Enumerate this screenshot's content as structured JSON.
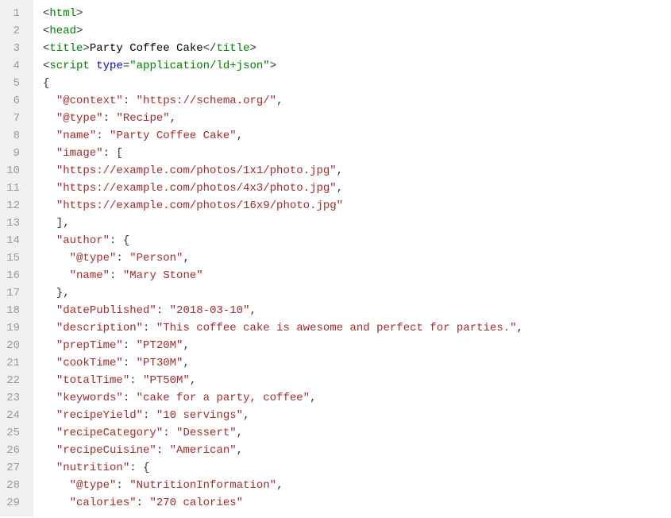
{
  "lines": [
    {
      "num": "1",
      "tokens": [
        [
          "punct",
          "<"
        ],
        [
          "tag",
          "html"
        ],
        [
          "punct",
          ">"
        ]
      ]
    },
    {
      "num": "2",
      "tokens": [
        [
          "punct",
          "<"
        ],
        [
          "tag",
          "head"
        ],
        [
          "punct",
          ">"
        ]
      ]
    },
    {
      "num": "3",
      "tokens": [
        [
          "punct",
          "<"
        ],
        [
          "tag",
          "title"
        ],
        [
          "punct",
          ">"
        ],
        [
          "text",
          "Party Coffee Cake"
        ],
        [
          "punct",
          "</"
        ],
        [
          "tag",
          "title"
        ],
        [
          "punct",
          ">"
        ]
      ]
    },
    {
      "num": "4",
      "tokens": [
        [
          "punct",
          "<"
        ],
        [
          "tag",
          "script"
        ],
        [
          "punct",
          " "
        ],
        [
          "attr",
          "type"
        ],
        [
          "punct",
          "="
        ],
        [
          "tag",
          "\"application/ld+json\""
        ],
        [
          "punct",
          ">"
        ]
      ]
    },
    {
      "num": "5",
      "tokens": [
        [
          "punct",
          "{"
        ]
      ]
    },
    {
      "num": "6",
      "tokens": [
        [
          "punct",
          "  "
        ],
        [
          "string",
          "\"@context\""
        ],
        [
          "punct",
          ": "
        ],
        [
          "string",
          "\"https://schema.org/\""
        ],
        [
          "punct",
          ","
        ]
      ]
    },
    {
      "num": "7",
      "tokens": [
        [
          "punct",
          "  "
        ],
        [
          "string",
          "\"@type\""
        ],
        [
          "punct",
          ": "
        ],
        [
          "string",
          "\"Recipe\""
        ],
        [
          "punct",
          ","
        ]
      ]
    },
    {
      "num": "8",
      "tokens": [
        [
          "punct",
          "  "
        ],
        [
          "string",
          "\"name\""
        ],
        [
          "punct",
          ": "
        ],
        [
          "string",
          "\"Party Coffee Cake\""
        ],
        [
          "punct",
          ","
        ]
      ]
    },
    {
      "num": "9",
      "tokens": [
        [
          "punct",
          "  "
        ],
        [
          "string",
          "\"image\""
        ],
        [
          "punct",
          ": ["
        ]
      ]
    },
    {
      "num": "10",
      "tokens": [
        [
          "punct",
          "  "
        ],
        [
          "string",
          "\"https://example.com/photos/1x1/photo.jpg\""
        ],
        [
          "punct",
          ","
        ]
      ]
    },
    {
      "num": "11",
      "tokens": [
        [
          "punct",
          "  "
        ],
        [
          "string",
          "\"https://example.com/photos/4x3/photo.jpg\""
        ],
        [
          "punct",
          ","
        ]
      ]
    },
    {
      "num": "12",
      "tokens": [
        [
          "punct",
          "  "
        ],
        [
          "string",
          "\"https://example.com/photos/16x9/photo.jpg\""
        ]
      ]
    },
    {
      "num": "13",
      "tokens": [
        [
          "punct",
          "  ],"
        ]
      ]
    },
    {
      "num": "14",
      "tokens": [
        [
          "punct",
          "  "
        ],
        [
          "string",
          "\"author\""
        ],
        [
          "punct",
          ": {"
        ]
      ]
    },
    {
      "num": "15",
      "tokens": [
        [
          "punct",
          "    "
        ],
        [
          "string",
          "\"@type\""
        ],
        [
          "punct",
          ": "
        ],
        [
          "string",
          "\"Person\""
        ],
        [
          "punct",
          ","
        ]
      ]
    },
    {
      "num": "16",
      "tokens": [
        [
          "punct",
          "    "
        ],
        [
          "string",
          "\"name\""
        ],
        [
          "punct",
          ": "
        ],
        [
          "string",
          "\"Mary Stone\""
        ]
      ]
    },
    {
      "num": "17",
      "tokens": [
        [
          "punct",
          "  },"
        ]
      ]
    },
    {
      "num": "18",
      "tokens": [
        [
          "punct",
          "  "
        ],
        [
          "string",
          "\"datePublished\""
        ],
        [
          "punct",
          ": "
        ],
        [
          "string",
          "\"2018-03-10\""
        ],
        [
          "punct",
          ","
        ]
      ]
    },
    {
      "num": "19",
      "tokens": [
        [
          "punct",
          "  "
        ],
        [
          "string",
          "\"description\""
        ],
        [
          "punct",
          ": "
        ],
        [
          "string",
          "\"This coffee cake is awesome and perfect for parties.\""
        ],
        [
          "punct",
          ","
        ]
      ]
    },
    {
      "num": "20",
      "tokens": [
        [
          "punct",
          "  "
        ],
        [
          "string",
          "\"prepTime\""
        ],
        [
          "punct",
          ": "
        ],
        [
          "string",
          "\"PT20M\""
        ],
        [
          "punct",
          ","
        ]
      ]
    },
    {
      "num": "21",
      "tokens": [
        [
          "punct",
          "  "
        ],
        [
          "string",
          "\"cookTime\""
        ],
        [
          "punct",
          ": "
        ],
        [
          "string",
          "\"PT30M\""
        ],
        [
          "punct",
          ","
        ]
      ]
    },
    {
      "num": "22",
      "tokens": [
        [
          "punct",
          "  "
        ],
        [
          "string",
          "\"totalTime\""
        ],
        [
          "punct",
          ": "
        ],
        [
          "string",
          "\"PT50M\""
        ],
        [
          "punct",
          ","
        ]
      ]
    },
    {
      "num": "23",
      "tokens": [
        [
          "punct",
          "  "
        ],
        [
          "string",
          "\"keywords\""
        ],
        [
          "punct",
          ": "
        ],
        [
          "string",
          "\"cake for a party, coffee\""
        ],
        [
          "punct",
          ","
        ]
      ]
    },
    {
      "num": "24",
      "tokens": [
        [
          "punct",
          "  "
        ],
        [
          "string",
          "\"recipeYield\""
        ],
        [
          "punct",
          ": "
        ],
        [
          "string",
          "\"10 servings\""
        ],
        [
          "punct",
          ","
        ]
      ]
    },
    {
      "num": "25",
      "tokens": [
        [
          "punct",
          "  "
        ],
        [
          "string",
          "\"recipeCategory\""
        ],
        [
          "punct",
          ": "
        ],
        [
          "string",
          "\"Dessert\""
        ],
        [
          "punct",
          ","
        ]
      ]
    },
    {
      "num": "26",
      "tokens": [
        [
          "punct",
          "  "
        ],
        [
          "string",
          "\"recipeCuisine\""
        ],
        [
          "punct",
          ": "
        ],
        [
          "string",
          "\"American\""
        ],
        [
          "punct",
          ","
        ]
      ]
    },
    {
      "num": "27",
      "tokens": [
        [
          "punct",
          "  "
        ],
        [
          "string",
          "\"nutrition\""
        ],
        [
          "punct",
          ": {"
        ]
      ]
    },
    {
      "num": "28",
      "tokens": [
        [
          "punct",
          "    "
        ],
        [
          "string",
          "\"@type\""
        ],
        [
          "punct",
          ": "
        ],
        [
          "string",
          "\"NutritionInformation\""
        ],
        [
          "punct",
          ","
        ]
      ]
    },
    {
      "num": "29",
      "tokens": [
        [
          "punct",
          "    "
        ],
        [
          "string",
          "\"calories\""
        ],
        [
          "punct",
          ": "
        ],
        [
          "string",
          "\"270 calories\""
        ]
      ]
    }
  ]
}
